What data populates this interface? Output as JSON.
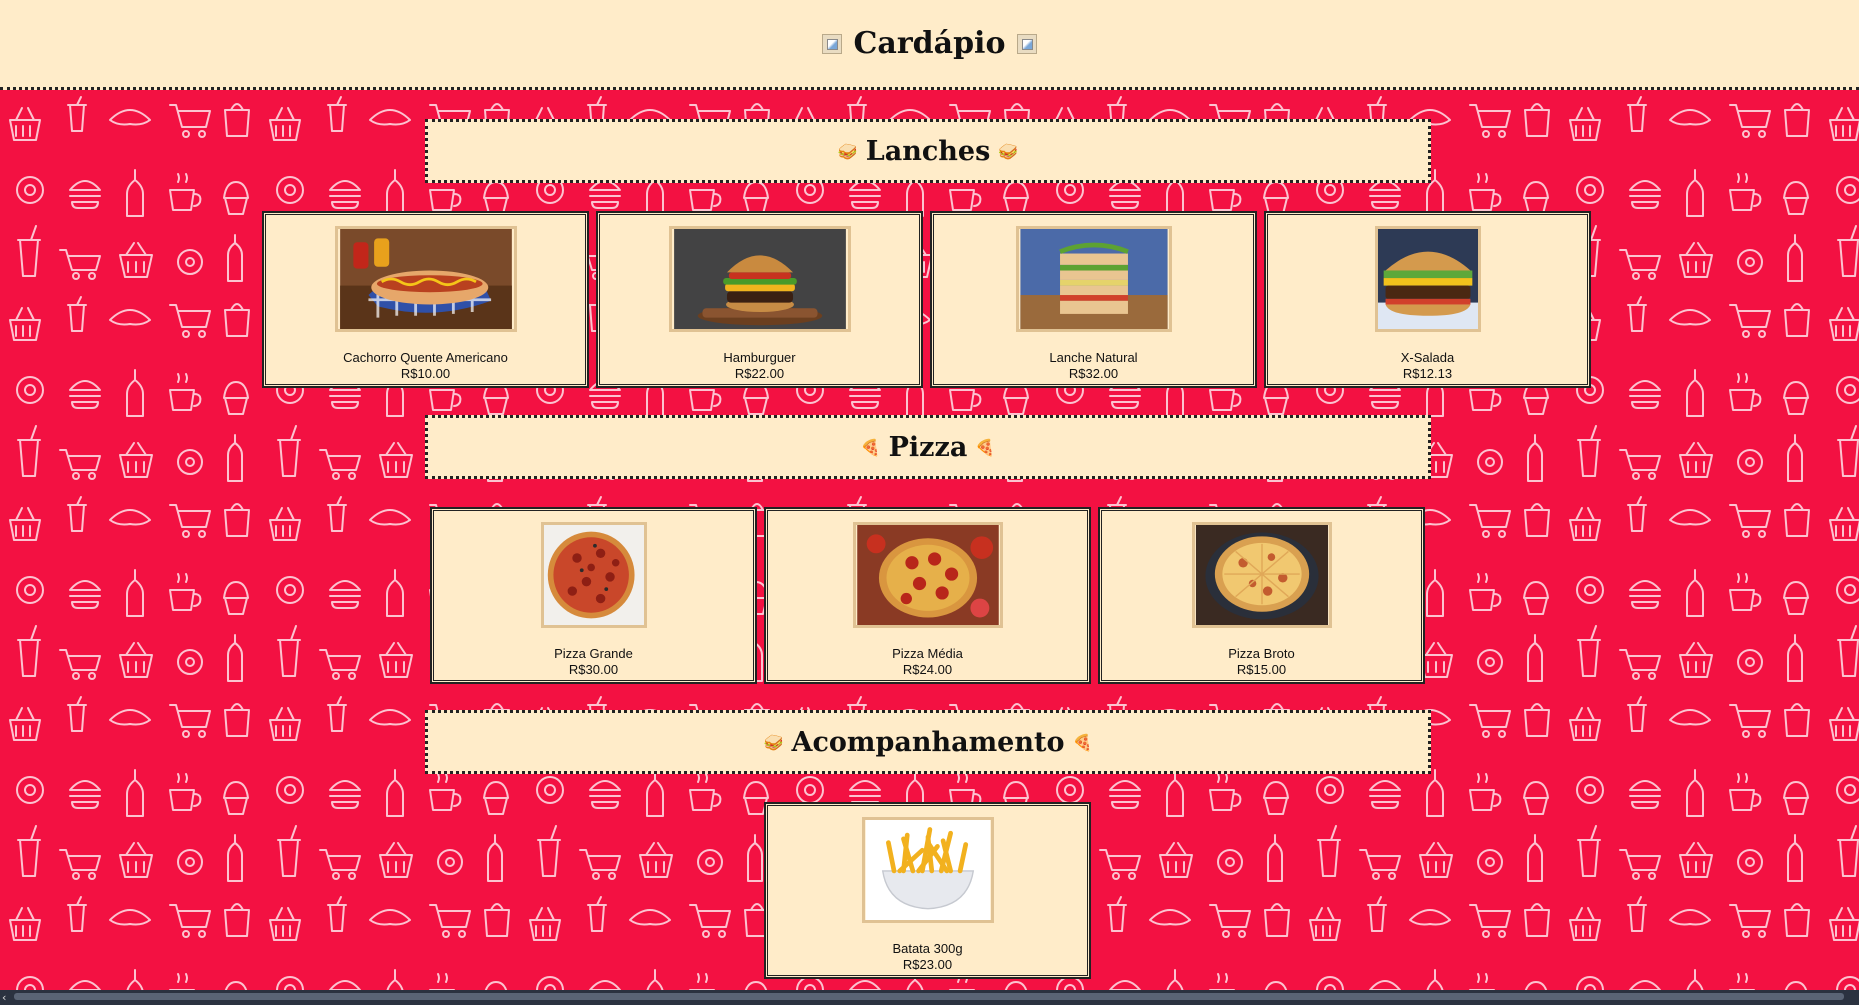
{
  "header": {
    "title": "Cardápio"
  },
  "colors": {
    "background": "#f31142",
    "panel": "#ffecc9",
    "border": "#222222",
    "photo_frame": "#e0c293"
  },
  "sections": {
    "lanches": {
      "title": "Lanches",
      "icon": "🥪",
      "items": [
        {
          "name": "Cachorro Quente Americano",
          "price": "R$10.00"
        },
        {
          "name": "Hamburguer",
          "price": "R$22.00"
        },
        {
          "name": "Lanche Natural",
          "price": "R$32.00"
        },
        {
          "name": "X-Salada",
          "price": "R$12.13"
        }
      ]
    },
    "pizza": {
      "title": "Pizza",
      "icon": "🍕",
      "items": [
        {
          "name": "Pizza Grande",
          "price": "R$30.00"
        },
        {
          "name": "Pizza Média",
          "price": "R$24.00"
        },
        {
          "name": "Pizza Broto",
          "price": "R$15.00"
        }
      ]
    },
    "acompanhamento": {
      "title": "Acompanhamento",
      "icon_left": "🥪",
      "icon_right": "🍕",
      "items": [
        {
          "name": "Batata 300g",
          "price": "R$23.00"
        }
      ]
    }
  }
}
